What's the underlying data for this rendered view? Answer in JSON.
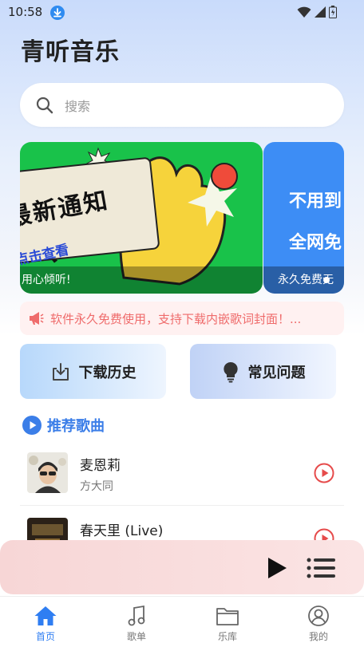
{
  "status_bar": {
    "time": "10:58"
  },
  "app": {
    "title": "青听音乐"
  },
  "search": {
    "placeholder": "搜索"
  },
  "banners": [
    {
      "headline": "最新通知",
      "subline": "点击查看",
      "caption": "用心倾听!"
    },
    {
      "line1": "不用到",
      "line2": "全网免",
      "caption": "永久免费无"
    }
  ],
  "notice": {
    "text": "软件永久免费使用，支持下载内嵌歌词封面！..."
  },
  "quick_actions": [
    {
      "label": "下载历史",
      "icon": "download-icon"
    },
    {
      "label": "常见问题",
      "icon": "lightbulb-icon"
    }
  ],
  "section": {
    "title": "推荐歌曲"
  },
  "songs": [
    {
      "title": "麦恩莉",
      "artist": "方大同"
    },
    {
      "title": "春天里 (Live)",
      "artist": ""
    }
  ],
  "nav": [
    {
      "label": "首页",
      "icon": "home-icon",
      "active": true
    },
    {
      "label": "歌单",
      "icon": "music-note-icon"
    },
    {
      "label": "乐库",
      "icon": "folder-icon"
    },
    {
      "label": "我的",
      "icon": "profile-icon"
    }
  ],
  "colors": {
    "accent": "#2f7ef2",
    "notice": "#ef6b6b",
    "play": "#e64b4b",
    "banner_green": "#19c24a",
    "banner_blue": "#3d8df5"
  }
}
